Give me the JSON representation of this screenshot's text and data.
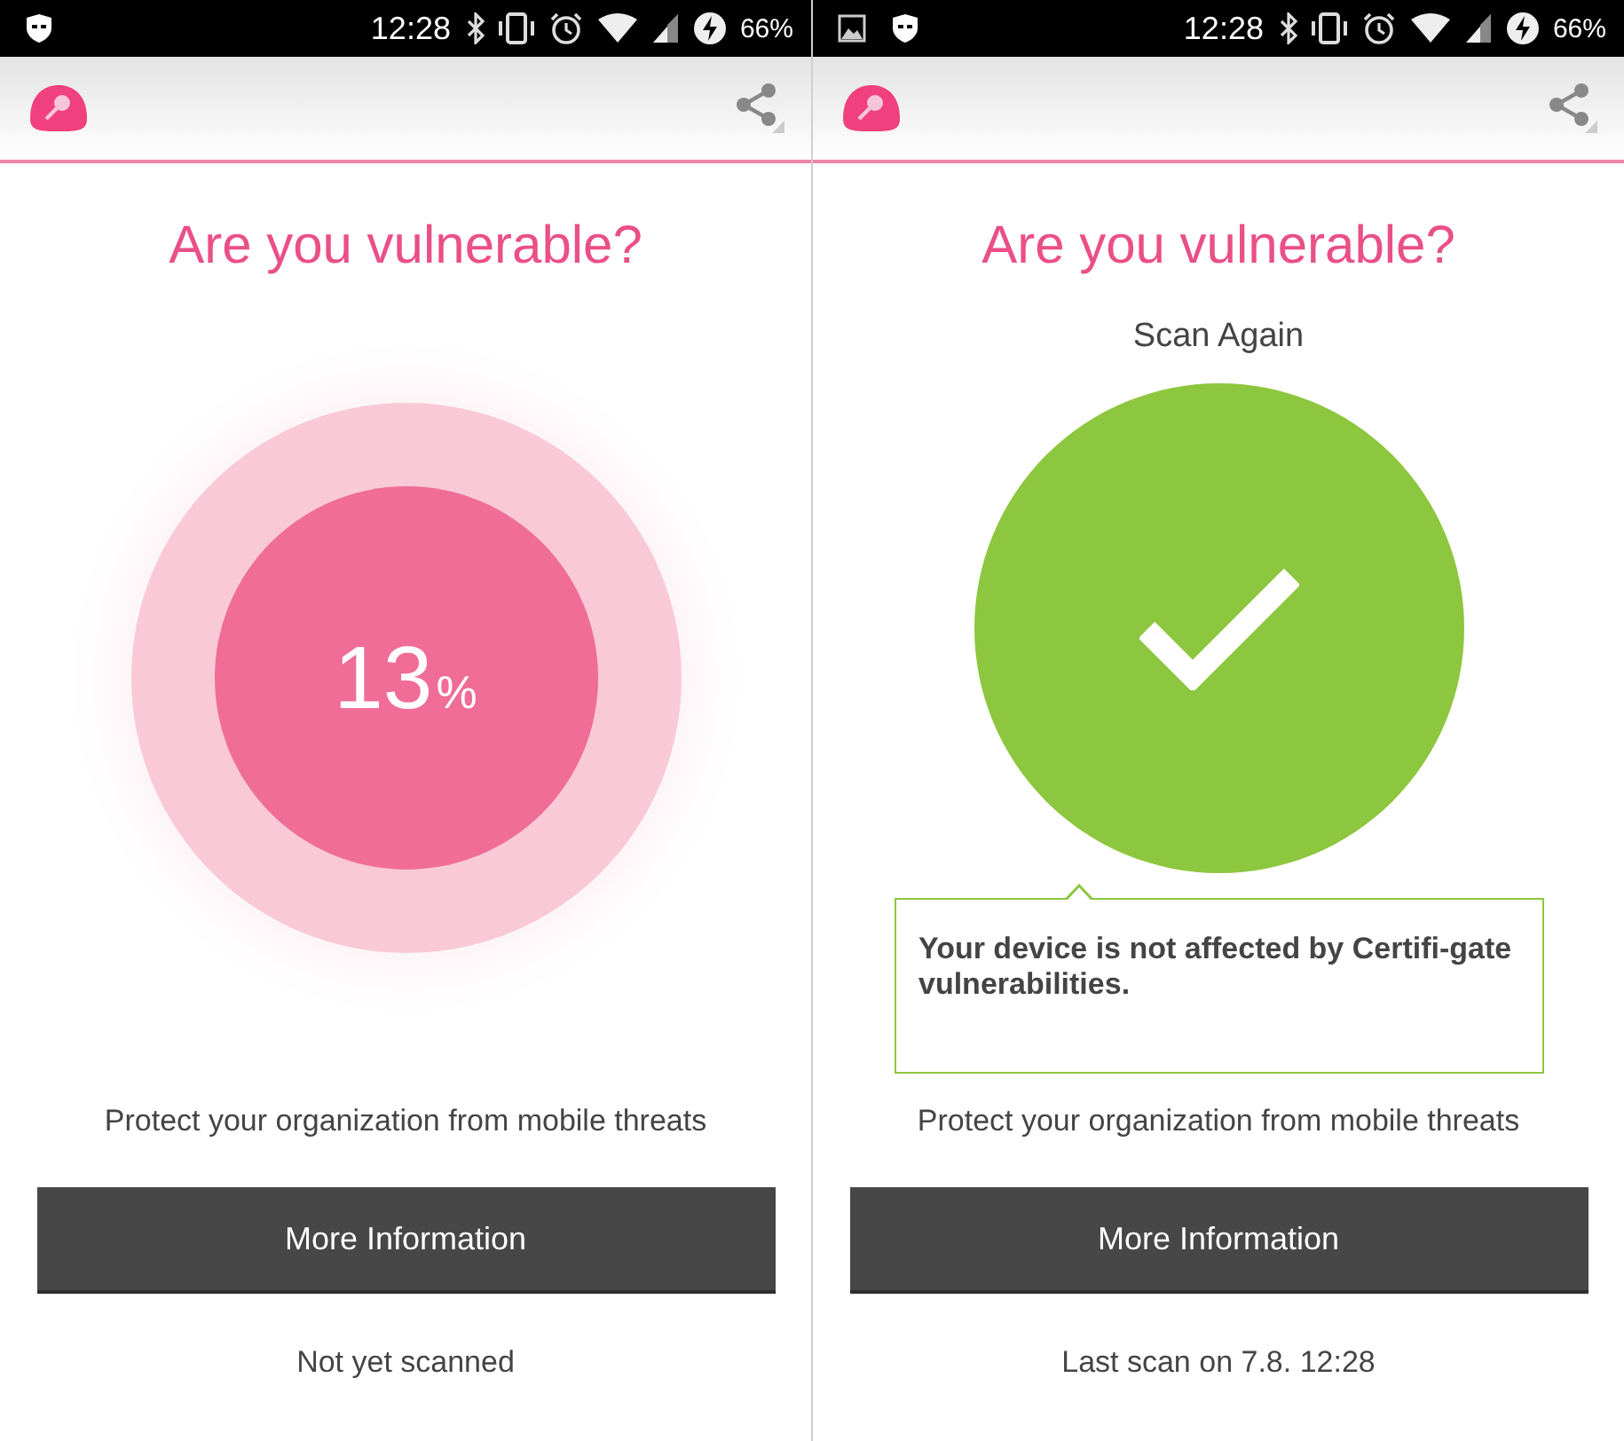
{
  "screens": [
    {
      "status_bar": {
        "notification_icons": [
          {
            "kind": "shield"
          }
        ],
        "time": "12:28",
        "battery": "66%"
      },
      "title": "Are you vulnerable?",
      "result": {
        "kind": "progress",
        "percent": "13",
        "unit": "%"
      },
      "tagline": "Protect your organization from mobile threats",
      "button": "More Information",
      "footer": "Not yet scanned"
    },
    {
      "status_bar": {
        "notification_icons": [
          {
            "kind": "image"
          },
          {
            "kind": "shield"
          }
        ],
        "time": "12:28",
        "battery": "66%"
      },
      "title": "Are you vulnerable?",
      "result": {
        "kind": "safe",
        "action": "Scan Again",
        "message": "Your device is not affected by Certifi-gate vulnerabilities."
      },
      "tagline": "Protect your organization from mobile threats",
      "button": "More Information",
      "footer": "Last scan on 7.8. 12:28"
    }
  ]
}
